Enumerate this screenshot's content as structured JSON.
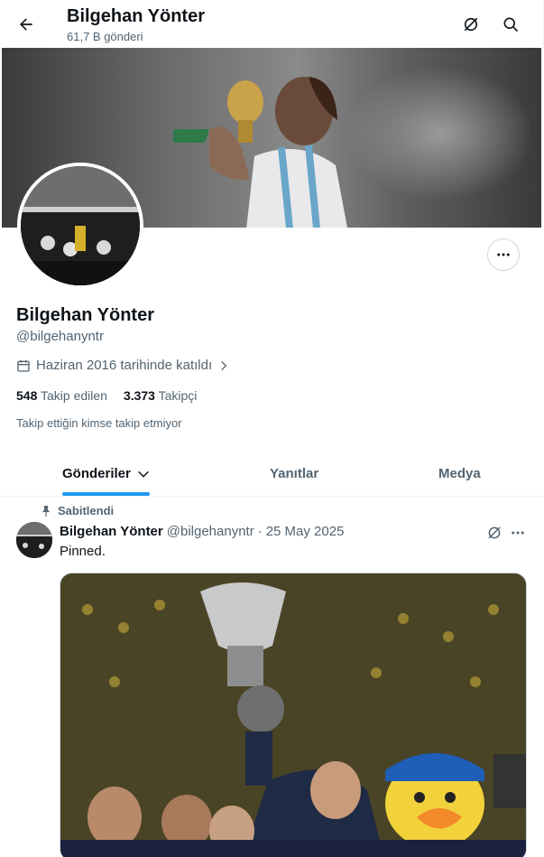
{
  "header": {
    "title": "Bilgehan Yönter",
    "post_count": "61,7 B gönderi"
  },
  "profile": {
    "name": "Bilgehan Yönter",
    "handle": "@bilgehanyntr",
    "joined": "Haziran 2016 tarihinde katıldı",
    "following_count": "548",
    "following_label": "Takip edilen",
    "followers_count": "3.373",
    "followers_label": "Takipçi",
    "mutual_note": "Takip ettiğin kimse takip etmiyor"
  },
  "tabs": [
    {
      "label": "Gönderiler",
      "active": true
    },
    {
      "label": "Yanıtlar",
      "active": false
    },
    {
      "label": "Medya",
      "active": false
    }
  ],
  "tweet": {
    "pinned_label": "Sabitlendi",
    "author_name": "Bilgehan Yönter",
    "author_handle": "@bilgehanyntr",
    "separator": "·",
    "date": "25 May 2025",
    "text": "Pinned."
  },
  "colors": {
    "accent": "#1d9bf0",
    "text_primary": "#0f1419",
    "text_secondary": "#536471"
  },
  "icons": {
    "back": "arrow-left-icon",
    "grok": "grok-icon",
    "search": "search-icon",
    "more": "more-horizontal-icon",
    "calendar": "calendar-icon",
    "pin": "pin-icon",
    "chevron_down": "chevron-down-icon",
    "chevron_right": "chevron-right-icon"
  }
}
